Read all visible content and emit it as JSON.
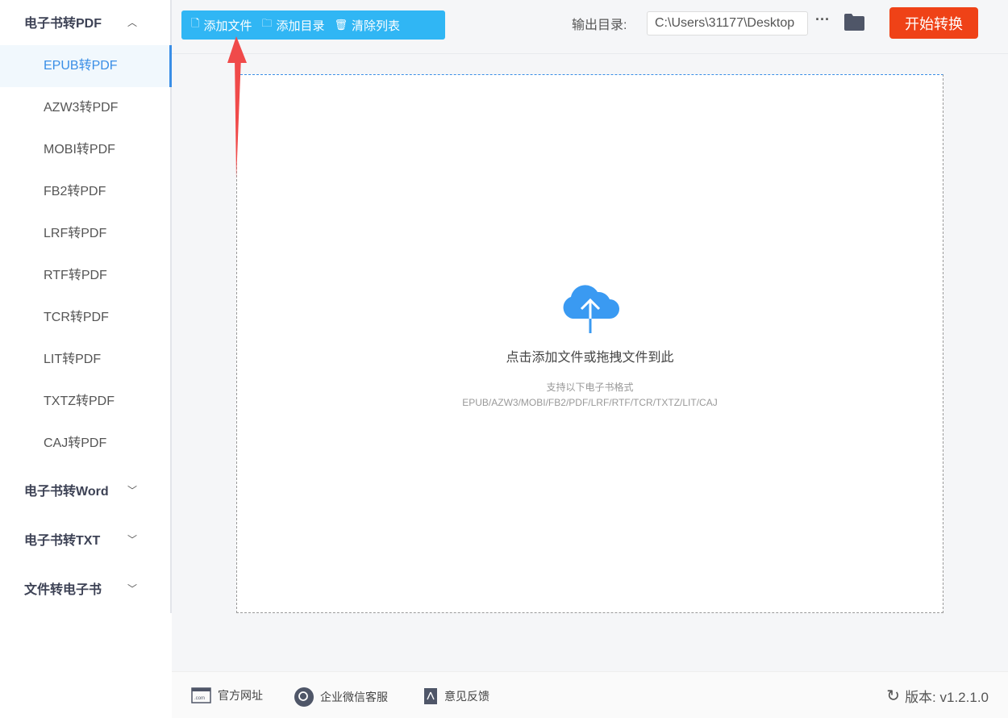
{
  "sidebar": {
    "groups": [
      {
        "label": "电子书转PDF",
        "expanded": true
      },
      {
        "label": "电子书转Word",
        "expanded": false
      },
      {
        "label": "电子书转TXT",
        "expanded": false
      },
      {
        "label": "文件转电子书",
        "expanded": false
      }
    ],
    "items": [
      {
        "label": "EPUB转PDF",
        "active": true
      },
      {
        "label": "AZW3转PDF"
      },
      {
        "label": "MOBI转PDF"
      },
      {
        "label": "FB2转PDF"
      },
      {
        "label": "LRF转PDF"
      },
      {
        "label": "RTF转PDF"
      },
      {
        "label": "TCR转PDF"
      },
      {
        "label": "LIT转PDF"
      },
      {
        "label": "TXTZ转PDF"
      },
      {
        "label": "CAJ转PDF"
      }
    ]
  },
  "toolbar": {
    "add_file": "添加文件",
    "add_folder": "添加目录",
    "clear_list": "清除列表",
    "output_label": "输出目录:",
    "output_path": "C:\\Users\\31177\\Desktop",
    "more": "···",
    "start": "开始转换"
  },
  "dropzone": {
    "title": "点击添加文件或拖拽文件到此",
    "subtitle": "支持以下电子书格式",
    "formats": "EPUB/AZW3/MOBI/FB2/PDF/LRF/RTF/TCR/TXTZ/LIT/CAJ"
  },
  "footer": {
    "website": "官方网址",
    "wechat": "企业微信客服",
    "feedback": "意见反馈",
    "version": "版本: v1.2.1.0"
  },
  "colors": {
    "accent": "#30b6f4",
    "active": "#3a8ee6",
    "start": "#ef4217",
    "annotation_arrow": "#f04a4a"
  }
}
